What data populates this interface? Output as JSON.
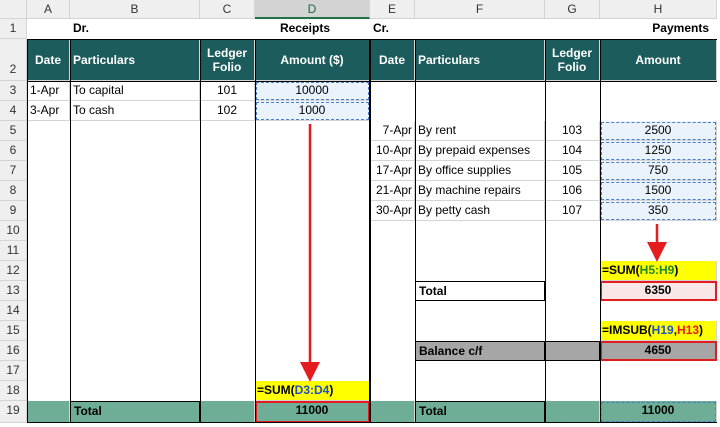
{
  "columns": [
    "A",
    "B",
    "C",
    "D",
    "E",
    "F",
    "G",
    "H"
  ],
  "rows": [
    "1",
    "2",
    "3",
    "4",
    "5",
    "6",
    "7",
    "8",
    "9",
    "10",
    "11",
    "12",
    "13",
    "14",
    "15",
    "16",
    "17",
    "18",
    "19"
  ],
  "row1": {
    "dr": "Dr.",
    "receipts": "Receipts",
    "cr": "Cr.",
    "payments": "Payments"
  },
  "headers": {
    "date": "Date",
    "particulars": "Particulars",
    "ledger_folio": "Ledger Folio",
    "amount_usd": "Amount ($)",
    "amount": "Amount"
  },
  "receipts": [
    {
      "date": "1-Apr",
      "particulars": "To capital",
      "folio": "101",
      "amount": "10000"
    },
    {
      "date": "3-Apr",
      "particulars": "To cash",
      "folio": "102",
      "amount": "1000"
    }
  ],
  "payments": [
    {
      "date": "7-Apr",
      "particulars": "By rent",
      "folio": "103",
      "amount": "2500"
    },
    {
      "date": "10-Apr",
      "particulars": "By prepaid expenses",
      "folio": "104",
      "amount": "1250"
    },
    {
      "date": "17-Apr",
      "particulars": "By office supplies",
      "folio": "105",
      "amount": "750"
    },
    {
      "date": "21-Apr",
      "particulars": "By machine repairs",
      "folio": "106",
      "amount": "1500"
    },
    {
      "date": "30-Apr",
      "particulars": "By petty cash",
      "folio": "107",
      "amount": "350"
    }
  ],
  "formulas": {
    "sum_h": {
      "prefix": "=SUM(",
      "ref": "H5:H9",
      "suffix": ")"
    },
    "imsub": {
      "prefix": "=IMSUB(",
      "ref1": "H19",
      "sep": ",",
      "ref2": "H13",
      "suffix": ")"
    },
    "sum_d": {
      "prefix": "=SUM(",
      "ref": "D3:D4",
      "suffix": ")"
    }
  },
  "totals": {
    "payments_label": "Total",
    "payments_total": "6350",
    "balance_label": "Balance c/f",
    "balance_value": "4650",
    "receipts_label": "Total",
    "receipts_total": "11000",
    "payments_grand_label": "Total",
    "payments_grand_total": "11000"
  },
  "colors": {
    "header_bg": "#1d5c5c",
    "total_bg": "#6fae96",
    "highlight": "#ffff00",
    "arrow": "#e31d1d"
  }
}
